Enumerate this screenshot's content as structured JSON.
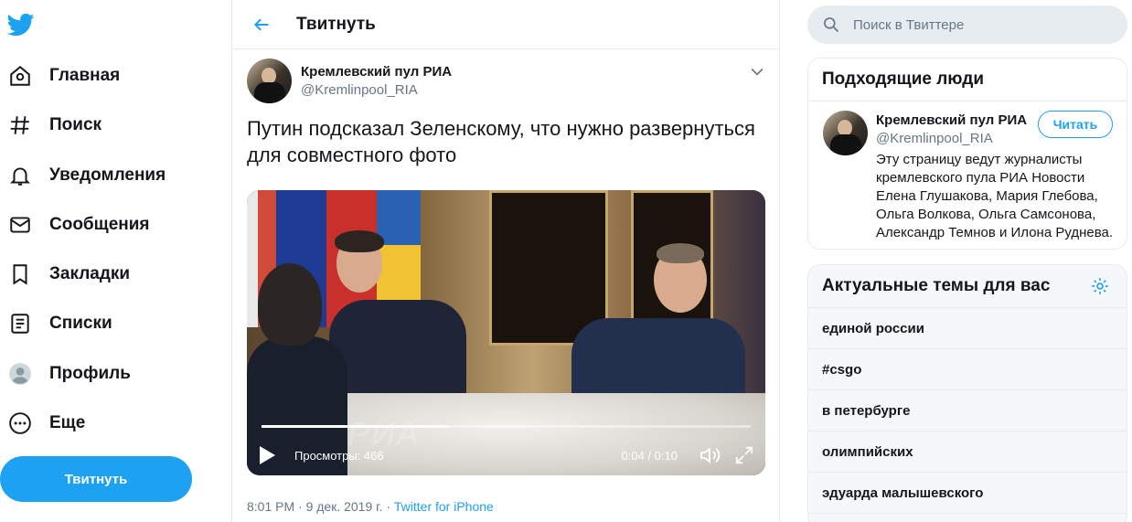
{
  "colors": {
    "accent": "#1da1f2",
    "text": "#14171a",
    "muted": "#657786",
    "border": "#e6ecf0"
  },
  "nav": {
    "items": [
      {
        "label": "Главная",
        "icon": "home-icon"
      },
      {
        "label": "Поиск",
        "icon": "hashtag-icon"
      },
      {
        "label": "Уведомления",
        "icon": "bell-icon"
      },
      {
        "label": "Сообщения",
        "icon": "envelope-icon"
      },
      {
        "label": "Закладки",
        "icon": "bookmark-icon"
      },
      {
        "label": "Списки",
        "icon": "list-icon"
      },
      {
        "label": "Профиль",
        "icon": "profile-icon"
      },
      {
        "label": "Еще",
        "icon": "more-icon"
      }
    ],
    "tweet_button": "Твитнуть"
  },
  "main": {
    "title": "Твитнуть",
    "tweet": {
      "author_name": "Кремлевский пул РИА",
      "author_handle": "@Kremlinpool_RIA",
      "text": "Путин подсказал Зеленскому, что нужно развернуться для совместного фото",
      "video": {
        "views": "Просмотры: 466",
        "time": "0:04 / 0:10",
        "progress": 0.38,
        "watermark": "РИА"
      },
      "timestamp": "8:01 PM · 9 дек. 2019 г. · ",
      "source": "Twitter for iPhone"
    }
  },
  "search": {
    "placeholder": "Поиск в Твиттере"
  },
  "who_to_follow": {
    "title": "Подходящие люди",
    "name": "Кремлевский пул РИА",
    "handle": "@Kremlinpool_RIA",
    "follow_label": "Читать",
    "bio": "Эту страницу ведут журналисты кремлевского пула РИА Новости Елена Глушакова, Мария Глебова, Ольга Волкова, Ольга Самсонова, Александр Темнов и Илона Руднева."
  },
  "trends": {
    "title": "Актуальные темы для вас",
    "items": [
      "единой россии",
      "#csgo",
      "в петербурге",
      "олимпийских",
      "эдуарда малышевского"
    ]
  }
}
